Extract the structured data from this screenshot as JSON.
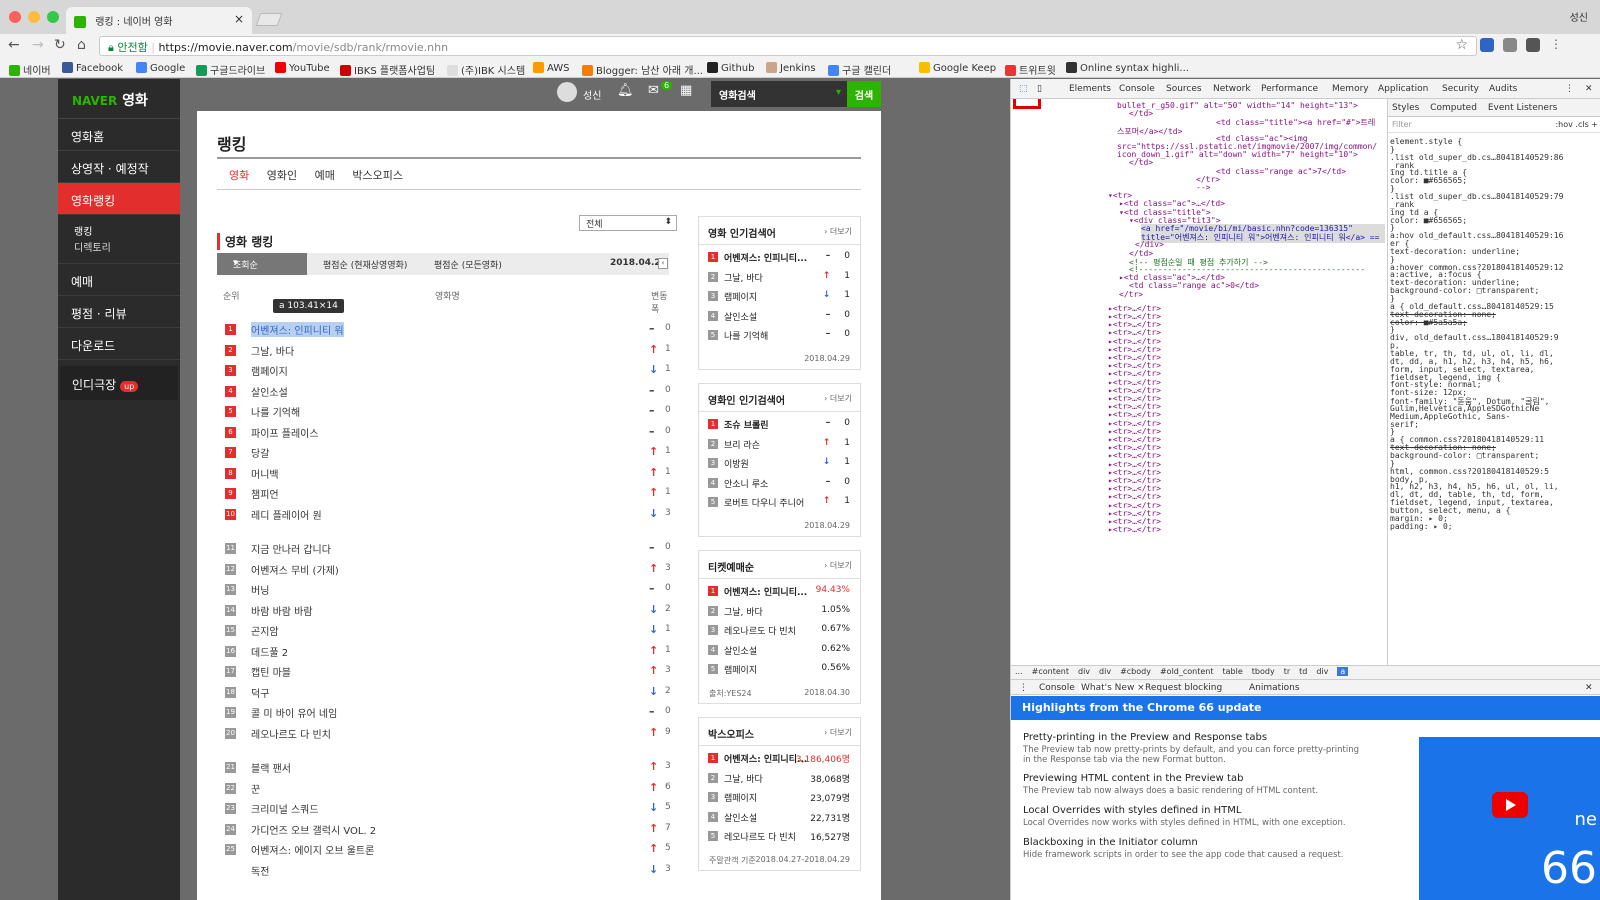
{
  "browser": {
    "tab_title": "랭킹 : 네이버 영화",
    "user": "성신",
    "secure_label": "안전함",
    "url_host": "https://movie.naver.com",
    "url_path": "/movie/sdb/rank/rmovie.nhn"
  },
  "bookmarks": [
    "네이버",
    "Facebook",
    "Google",
    "구글드라이브",
    "YouTube",
    "IBKS 플랫폼사업팀",
    "(주)IBK 시스템",
    "AWS",
    "Blogger: 남산 아래 개...",
    "Github",
    "Jenkins",
    "구글 캘린더",
    "Google Keep",
    "트위트윗",
    "Online syntax highli..."
  ],
  "naver": {
    "logo": "NAVER",
    "logo_sub": "영화",
    "menu": [
      "영화홈",
      "상영작 · 예정작",
      "영화랭킹",
      "예매",
      "평점 · 리뷰",
      "다운로드"
    ],
    "submenu": [
      "랭킹",
      "디렉토리"
    ],
    "indie": "인디극장",
    "indie_badge": "up",
    "user": "성신",
    "search_placeholder": "영화검색",
    "search_btn": "검색",
    "mail_count": "6"
  },
  "page": {
    "title": "랭킹",
    "tabs": [
      "영화",
      "영화인",
      "예매",
      "박스오피스"
    ],
    "select": "전체",
    "section": "영화 랭킹",
    "sort_tabs": [
      "조회순",
      "평점순 (현재상영영화)",
      "평점순 (모든영화)"
    ],
    "date": "2018.04.29",
    "col_rank": "순위",
    "col_name": "영화명",
    "col_change": "변동폭",
    "tooltip": "a  103.41×14"
  },
  "ranking": [
    {
      "n": "1",
      "name": "어벤져스: 인피니티 워",
      "dir": "eq",
      "chg": "0"
    },
    {
      "n": "2",
      "name": "그날, 바다",
      "dir": "up",
      "chg": "1"
    },
    {
      "n": "3",
      "name": "램페이지",
      "dir": "dn",
      "chg": "1"
    },
    {
      "n": "4",
      "name": "살인소설",
      "dir": "eq",
      "chg": "0"
    },
    {
      "n": "5",
      "name": "나를 기억해",
      "dir": "eq",
      "chg": "0"
    },
    {
      "n": "6",
      "name": "파이프 플레이스",
      "dir": "eq",
      "chg": "0"
    },
    {
      "n": "7",
      "name": "당갈",
      "dir": "up",
      "chg": "1"
    },
    {
      "n": "8",
      "name": "머니백",
      "dir": "up",
      "chg": "1"
    },
    {
      "n": "9",
      "name": "챔피언",
      "dir": "up",
      "chg": "1"
    },
    {
      "n": "10",
      "name": "레디 플레이어 원",
      "dir": "dn",
      "chg": "3"
    },
    {
      "n": "11",
      "name": "지금 만나러 갑니다",
      "dir": "eq",
      "chg": "0"
    },
    {
      "n": "12",
      "name": "어벤져스 무비 (가제)",
      "dir": "up",
      "chg": "3"
    },
    {
      "n": "13",
      "name": "버닝",
      "dir": "eq",
      "chg": "0"
    },
    {
      "n": "14",
      "name": "바람 바람 바람",
      "dir": "dn",
      "chg": "2"
    },
    {
      "n": "15",
      "name": "곤지암",
      "dir": "dn",
      "chg": "1"
    },
    {
      "n": "16",
      "name": "데드풀 2",
      "dir": "up",
      "chg": "1"
    },
    {
      "n": "17",
      "name": "캡틴 마블",
      "dir": "up",
      "chg": "3"
    },
    {
      "n": "18",
      "name": "덕구",
      "dir": "dn",
      "chg": "2"
    },
    {
      "n": "19",
      "name": "콜 미 바이 유어 네임",
      "dir": "eq",
      "chg": "0"
    },
    {
      "n": "20",
      "name": "레오나르도 다 빈치",
      "dir": "up",
      "chg": "9"
    },
    {
      "n": "21",
      "name": "블랙 팬서",
      "dir": "up",
      "chg": "3"
    },
    {
      "n": "22",
      "name": "꾼",
      "dir": "up",
      "chg": "6"
    },
    {
      "n": "23",
      "name": "크리미널 스쿼드",
      "dir": "dn",
      "chg": "5"
    },
    {
      "n": "24",
      "name": "가디언즈 오브 갤럭시 VOL. 2",
      "dir": "up",
      "chg": "7"
    },
    {
      "n": "25",
      "name": "어벤져스: 에이지 오브 울트론",
      "dir": "up",
      "chg": "5"
    },
    {
      "n": "",
      "name": "독전",
      "dir": "dn",
      "chg": "3"
    }
  ],
  "side_boxes": [
    {
      "title": "영화 인기검색어",
      "more": "더보기",
      "items": [
        [
          "어벤져스: 인피니티...",
          "eq",
          "0"
        ],
        [
          "그날, 바다",
          "up",
          "1"
        ],
        [
          "램페이지",
          "dn",
          "1"
        ],
        [
          "살인소설",
          "eq",
          "0"
        ],
        [
          "나를 기억해",
          "eq",
          "0"
        ]
      ],
      "foot_left": "",
      "foot": "2018.04.29"
    },
    {
      "title": "영화인 인기검색어",
      "more": "더보기",
      "items": [
        [
          "조슈 브롤린",
          "eq",
          "0"
        ],
        [
          "브리 라슨",
          "up",
          "1"
        ],
        [
          "이방원",
          "dn",
          "1"
        ],
        [
          "안소니 루소",
          "eq",
          "0"
        ],
        [
          "로버트 다우니 주니어",
          "up",
          "1"
        ]
      ],
      "foot_left": "",
      "foot": "2018.04.29"
    },
    {
      "title": "티켓예매순",
      "more": "더보기",
      "items": [
        [
          "어벤져스: 인피니티...",
          "94.43%"
        ],
        [
          "그날, 바다",
          "1.05%"
        ],
        [
          "레오나르도 다 빈치",
          "0.67%"
        ],
        [
          "살인소설",
          "0.62%"
        ],
        [
          "램페이지",
          "0.56%"
        ]
      ],
      "foot_left": "출처:YES24",
      "foot": "2018.04.30"
    },
    {
      "title": "박스오피스",
      "more": "더보기",
      "items": [
        [
          "어벤져스: 인피니티...",
          "3,186,406명"
        ],
        [
          "그날, 바다",
          "38,068명"
        ],
        [
          "램페이지",
          "23,079명"
        ],
        [
          "살인소설",
          "22,731명"
        ],
        [
          "레오나르도 다 빈치",
          "16,527명"
        ]
      ],
      "foot_left": "주말관객 기준",
      "foot": "2018.04.27-2018.04.29"
    }
  ],
  "devtools": {
    "tabs": [
      "Elements",
      "Console",
      "Sources",
      "Network",
      "Performance",
      "Memory",
      "Application",
      "Security",
      "Audits"
    ],
    "style_tabs": [
      "Styles",
      "Computed",
      "Event Listeners"
    ],
    "filter": "Filter",
    "pseudo": ":hov  .cls  +",
    "elements": [
      "bullet_r_g50.gif\" alt=\"50\" width=\"14\" height=\"13\">",
      "</td>",
      "<td class=\"title\"><a href=\"#\">트레",
      "스포머</a></td>",
      "<td class=\"ac\"><img",
      "src=\"https://ssl.pstatic.net/imgmovie/2007/img/common/",
      "icon_down_1.gif\" alt=\"down\" width=\"7\" height=\"10\">",
      "</td>",
      "<td class=\"range ac\">7</td>",
      "</tr>",
      "-->",
      "▾<tr>",
      "▸<td class=\"ac\">…</td>",
      "▾<td class=\"title\">",
      "▾<div class=\"tit3\">",
      "<a href=\"/movie/bi/mi/basic.nhn?code=136315\"",
      "title=\"어벤져스: 인피니티 워\">어벤져스: 인피니티 워</a> ==",
      "</div>",
      "</td>",
      "<!-- 평점순일 때 평점 추가하기  -->",
      "<!-----------------------------------------------",
      "▸<td class=\"ac\">…</td>",
      "<td class=\"range ac\">0</td>",
      "</tr>"
    ],
    "collapsed_tr": "▸<tr>…</tr>",
    "styles": [
      "element.style {",
      "}",
      ".list  old_super_db.cs…80418140529:86",
      "_rank",
      "ing td.title a {",
      "  color: ■#656565;",
      "}",
      ".list  old_super_db.cs…80418140529:79",
      "_rank",
      "ing td a {",
      "  color: ■#656565;",
      "}",
      "a:hov  old_default.css…80418140529:16",
      "er {",
      "  text-decoration: underline;",
      "}",
      "a:hover  common.css?20180418140529:12",
      "a:active, a:focus {",
      "  text-decoration: underline;",
      "  background-color: □transparent;",
      "}",
      "a {  old_default.css…80418140529:15",
      "  text-decoration: none;",
      "  color: ■#5a5a5a;",
      "}",
      "div,  old_default.css…180418140529:9",
      "p,",
      "table, tr, th, td, ul, ol, li, dl,",
      "dt, dd, a, h1, h2, h3, h4, h5, h6,",
      "form, input, select, textarea,",
      "fieldset, legend, img {",
      "  font-style: normal;",
      "  font-size: 12px;",
      "  font-family: \"돋움\", Dotum, \"굴림\",",
      "    Gulim,Helvetica,AppleSDGothicNe",
      "    Medium,AppleGothic, Sans-",
      "    serif;",
      "}",
      "a {      common.css?20180418140529:11",
      "  text-decoration: none;",
      "  background-color: □transparent;",
      "}",
      "html,  common.css?20180418140529:5",
      "body, p,",
      "h1, h2, h3, h4, h5, h6, ul, ol, li,",
      "dl, dt, dd, table, th, td, form,",
      "fieldset, legend, input, textarea,",
      "button, select, menu, a {",
      "  margin: ▸ 0;",
      "  padding: ▸ 0;"
    ],
    "crumbs": [
      "...",
      "#content",
      "div",
      "div",
      "#cbody",
      "#old_content",
      "table",
      "tbody",
      "tr",
      "td",
      "div",
      "a"
    ],
    "drawer_tabs": [
      "Console",
      "What's New ×",
      "Request blocking",
      "Animations"
    ],
    "whats_new_title": "Highlights from the Chrome 66 update",
    "features": [
      {
        "t": "Pretty-printing in the Preview and Response tabs",
        "d": "The Preview tab now pretty-prints by default, and you can force pretty-printing in the Response tab via the new Format button."
      },
      {
        "t": "Previewing HTML content in the Preview tab",
        "d": "The Preview tab now always does a basic rendering of HTML content."
      },
      {
        "t": "Local Overrides with styles defined in HTML",
        "d": "Local Overrides now works with styles defined in HTML, with one exception."
      },
      {
        "t": "Blackboxing in the Initiator column",
        "d": "Hide framework scripts in order to see the app code that caused a request."
      }
    ],
    "video_text": "ne",
    "video_num": "66"
  }
}
